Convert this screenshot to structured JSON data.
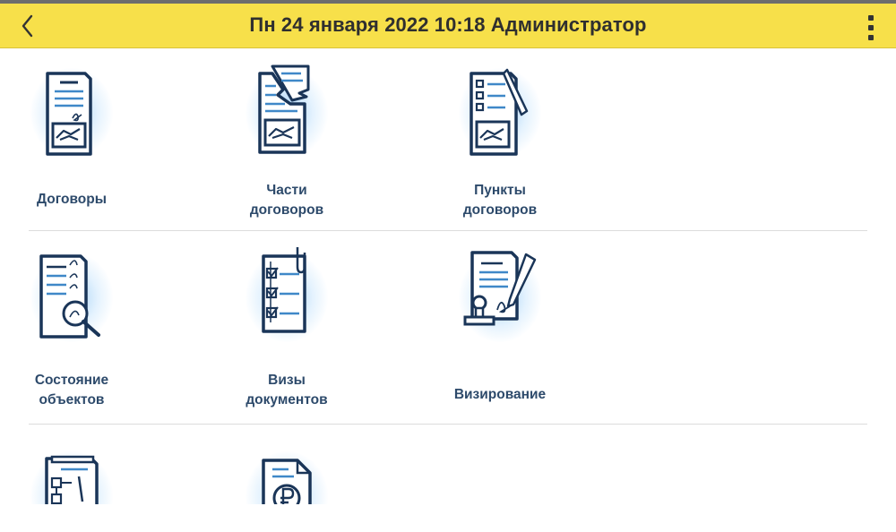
{
  "header": {
    "title": "Пн 24 января 2022 10:18 Администратор",
    "back_icon": "chevron-left-icon",
    "menu_icon": "kebab-menu-icon"
  },
  "colors": {
    "header_bg": "#f7e04a",
    "icon_navy": "#1a3558",
    "icon_blue": "#3f88c8",
    "label": "#2d4a6b"
  },
  "tiles": [
    {
      "id": "contracts",
      "lines": [
        "Договоры"
      ],
      "icon": "contract-handshake-icon"
    },
    {
      "id": "contract-parts",
      "lines": [
        "Части",
        "договоров"
      ],
      "icon": "torn-contract-handshake-icon"
    },
    {
      "id": "contract-points",
      "lines": [
        "Пункты",
        "договоров"
      ],
      "icon": "checklist-pen-handshake-icon"
    },
    {
      "id": "object-status",
      "lines": [
        "Состояние",
        "объектов"
      ],
      "icon": "document-magnifier-icon"
    },
    {
      "id": "document-visas",
      "lines": [
        "Визы",
        "документов"
      ],
      "icon": "clipped-checklist-icon"
    },
    {
      "id": "approval",
      "lines": [
        "Визирование"
      ],
      "icon": "stamp-signature-icon"
    },
    {
      "id": "flowchart-document",
      "lines": [],
      "icon": "flowchart-document-icon"
    },
    {
      "id": "ruble-document",
      "lines": [],
      "icon": "ruble-document-icon"
    }
  ]
}
